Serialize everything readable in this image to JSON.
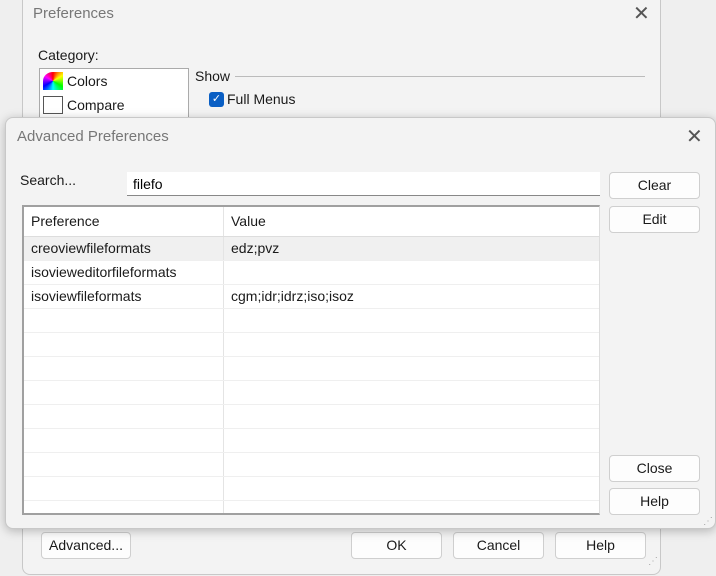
{
  "preferences": {
    "title": "Preferences",
    "category_label": "Category:",
    "categories": [
      "Colors",
      "Compare"
    ],
    "show_label": "Show",
    "checkboxes": [
      {
        "label": "Full Menus",
        "checked": true
      }
    ],
    "buttons": {
      "advanced": "Advanced...",
      "ok": "OK",
      "cancel": "Cancel",
      "help": "Help"
    }
  },
  "advanced": {
    "title": "Advanced Preferences",
    "search_label": "Search...",
    "search_value": "filefo",
    "buttons": {
      "clear": "Clear",
      "edit": "Edit",
      "close": "Close",
      "help": "Help"
    },
    "columns": [
      "Preference",
      "Value"
    ],
    "rows": [
      [
        "creoviewfileformats",
        "edz;pvz"
      ],
      [
        "isovieweditorfileformats",
        ""
      ],
      [
        "isoviewfileformats",
        "cgm;idr;idrz;iso;isoz"
      ]
    ]
  }
}
